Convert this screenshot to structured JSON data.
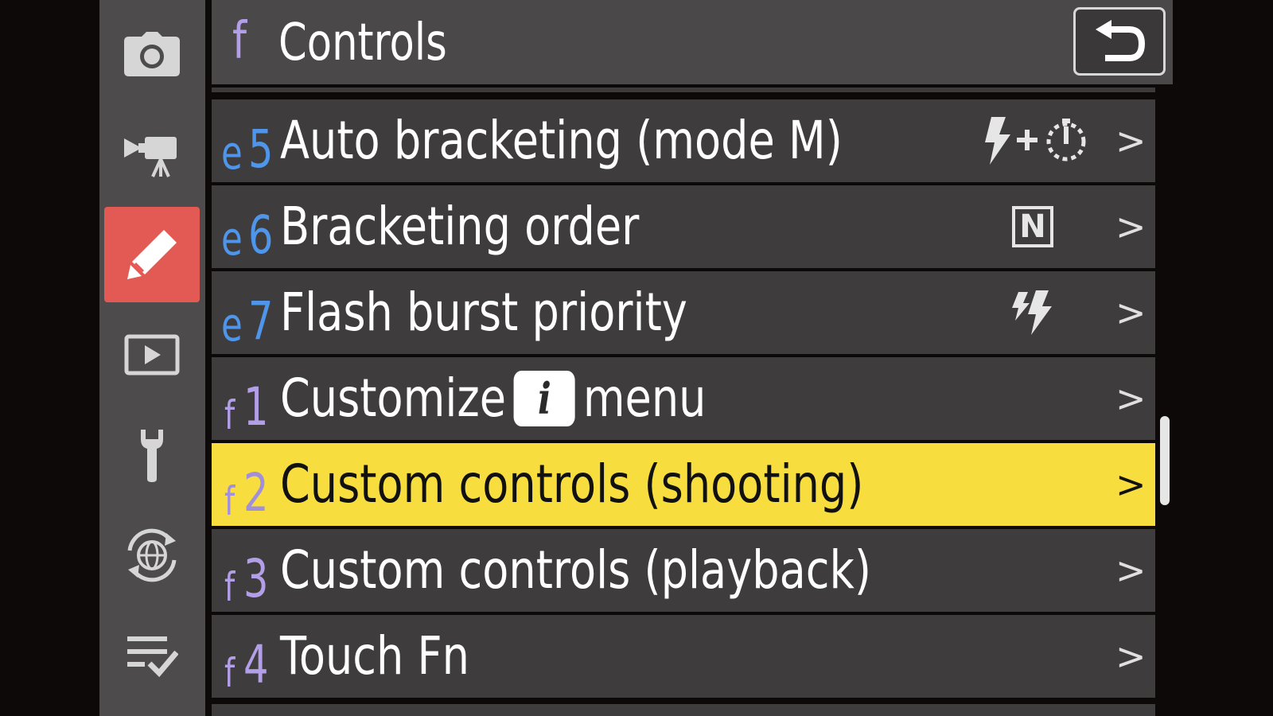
{
  "screen": {
    "colors": {
      "background": "#0d0909",
      "sidebar": "#4d4b4b",
      "active_tab": "#e35a55",
      "row": "#3e3c3c",
      "selected_row": "#f7dd3e",
      "e_code": "#4f95ea",
      "f_code": "#b39fe8"
    }
  },
  "sidebar": {
    "tabs": [
      {
        "icon": "camera-icon",
        "name": "Photo shooting menu",
        "active": false
      },
      {
        "icon": "movie-camera-icon",
        "name": "Video recording menu",
        "active": false
      },
      {
        "icon": "pencil-icon",
        "name": "Custom settings menu",
        "active": true
      },
      {
        "icon": "playback-icon",
        "name": "Playback menu",
        "active": false
      },
      {
        "icon": "wrench-icon",
        "name": "Setup menu",
        "active": false
      },
      {
        "icon": "network-icon",
        "name": "Network menu",
        "active": false
      },
      {
        "icon": "my-menu-icon",
        "name": "My menu",
        "active": false
      }
    ]
  },
  "header": {
    "group_letter": "f",
    "title": "Controls",
    "back_icon": "return-arrow-icon"
  },
  "menu": {
    "items": [
      {
        "letter": "e",
        "num": "5",
        "label": "Auto bracketing (mode M)",
        "value_icon": "flash-plus-speed-icon",
        "chevron": ">",
        "selected": false
      },
      {
        "letter": "e",
        "num": "6",
        "label": "Bracketing order",
        "value_icon": "n-box-icon",
        "value_text": "N",
        "chevron": ">",
        "selected": false
      },
      {
        "letter": "e",
        "num": "7",
        "label": "Flash burst priority",
        "value_icon": "flash-burst-icon",
        "chevron": ">",
        "selected": false
      },
      {
        "letter": "f",
        "num": "1",
        "label_before": "Customize",
        "label_icon": "i",
        "label_after": "menu",
        "chevron": ">",
        "selected": false
      },
      {
        "letter": "f",
        "num": "2",
        "label": "Custom controls (shooting)",
        "chevron": ">",
        "selected": true
      },
      {
        "letter": "f",
        "num": "3",
        "label": "Custom controls (playback)",
        "chevron": ">",
        "selected": false
      },
      {
        "letter": "f",
        "num": "4",
        "label": "Touch Fn",
        "chevron": ">",
        "selected": false
      }
    ]
  },
  "scrollbar": {
    "position": 0.55
  }
}
